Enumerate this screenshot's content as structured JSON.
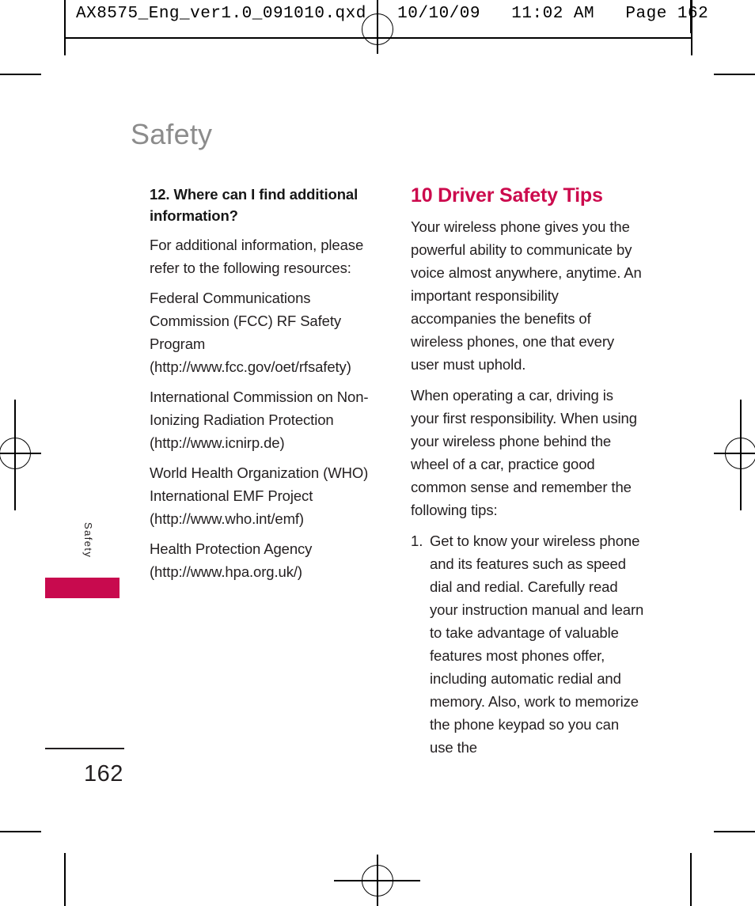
{
  "print_slug": "AX8575_Eng_ver1.0_091010.qxd   10/10/09   11:02 AM   Page 162",
  "page": {
    "title": "Safety",
    "folio": "162",
    "tab_label": "Safety",
    "accent_color": "#c80a4e",
    "heading_color": "#cc0a4d",
    "title_color": "#8c8c8c"
  },
  "left_column": {
    "question_heading": "12. Where can I find additional information?",
    "paragraphs": [
      "For additional information, please refer to the following resources:",
      "Federal Communications Commission (FCC) RF Safety Program (http://www.fcc.gov/oet/rfsafety)",
      "International Commission on Non-Ionizing Radiation Protection (http://www.icnirp.de)",
      "World Health Organization (WHO) International EMF Project (http://www.who.int/emf)",
      "Health Protection Agency (http://www.hpa.org.uk/)"
    ]
  },
  "right_column": {
    "section_heading": "10 Driver Safety Tips",
    "paragraphs": [
      "Your wireless phone gives you the powerful ability to communicate by voice almost anywhere, anytime. An important responsibility accompanies the benefits of wireless phones, one that every user must uphold.",
      "When operating a car, driving is your first responsibility. When using your wireless phone behind the wheel of a car, practice good common sense and remember the following tips:"
    ],
    "list": [
      {
        "number": "1.",
        "text": "Get to know your wireless phone and its features such as speed dial and redial. Carefully read your instruction manual and learn to take advantage of valuable features most phones offer, including automatic redial and memory. Also, work to memorize the phone keypad so you can use the"
      }
    ]
  }
}
